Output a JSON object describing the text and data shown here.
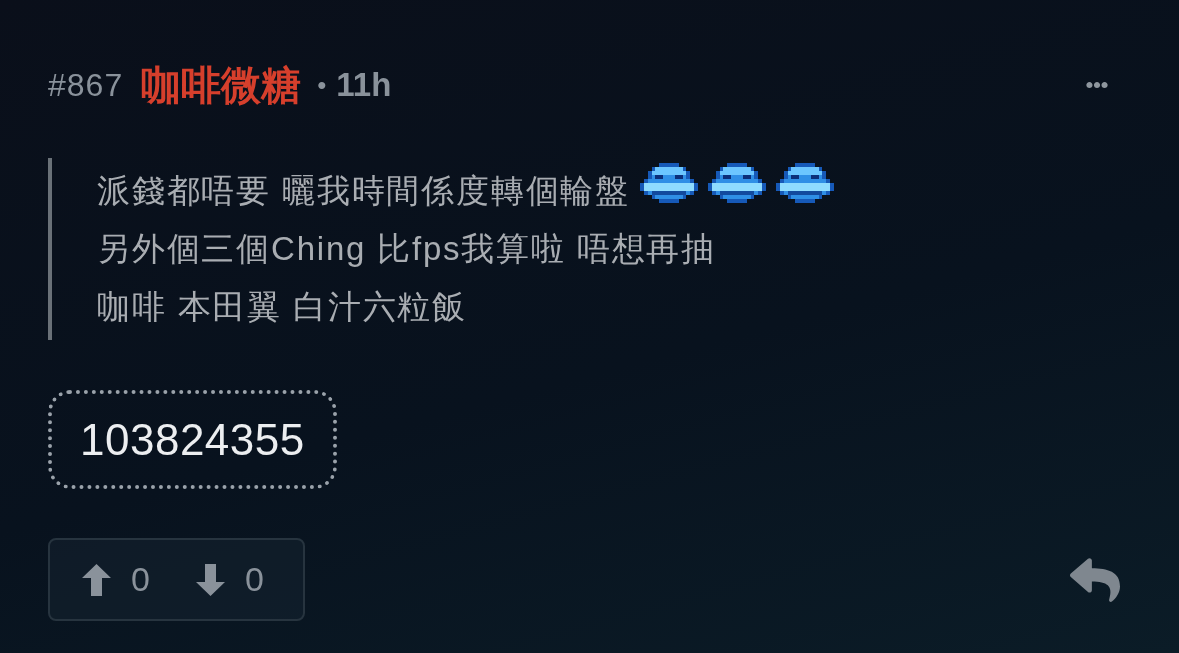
{
  "post": {
    "number": "#867",
    "author": "咖啡微糖",
    "separator": "•",
    "time": "11h"
  },
  "quote": {
    "lines": [
      {
        "segments": [
          {
            "kind": "text",
            "text": "派錢都唔要 曬我時間係度轉個輪盤"
          },
          {
            "kind": "emoji"
          },
          {
            "kind": "emoji"
          },
          {
            "kind": "emoji"
          }
        ]
      },
      {
        "segments": [
          {
            "kind": "text",
            "text": "另外個三個Ching 比fps我算啦 唔想再抽"
          }
        ]
      },
      {
        "segments": [
          {
            "kind": "text",
            "text": "咖啡 本田翼 白汁六粒飯"
          }
        ]
      }
    ]
  },
  "code": "103824355",
  "votes": [
    {
      "kind": "up",
      "count": "0"
    },
    {
      "kind": "down",
      "count": "0"
    }
  ]
}
